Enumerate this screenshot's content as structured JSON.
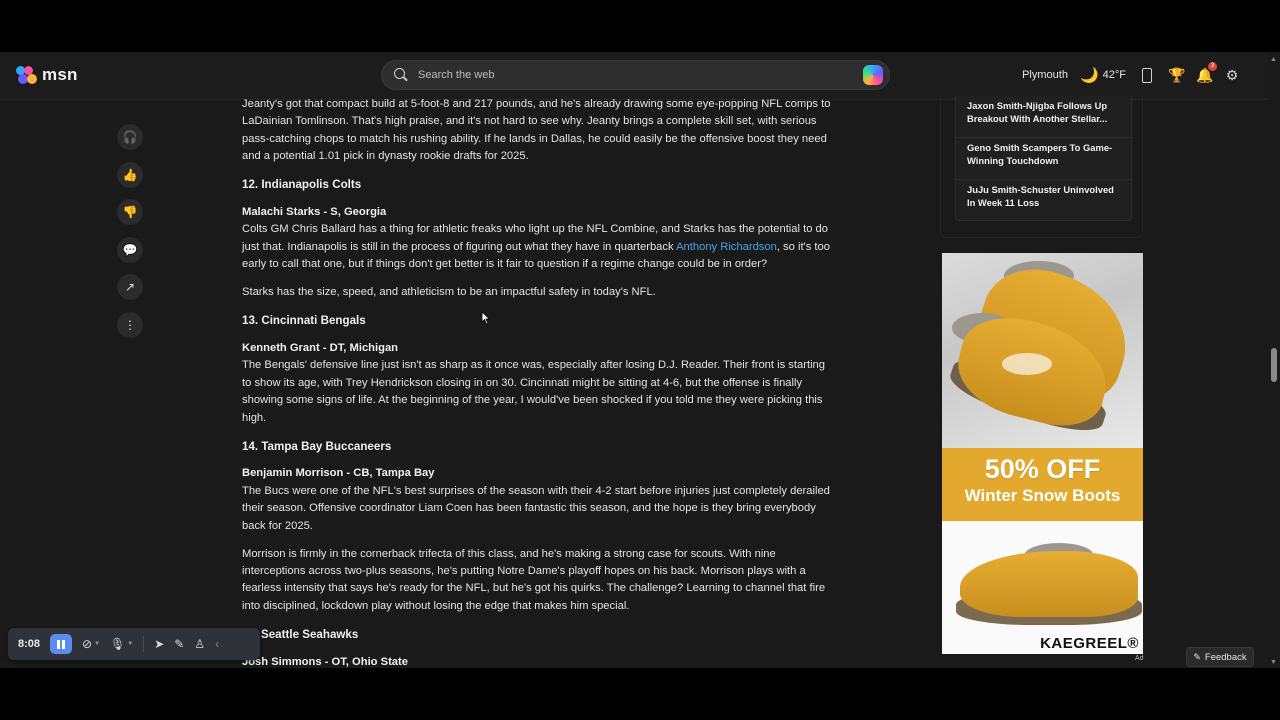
{
  "header": {
    "logo_text": "msn",
    "search_placeholder": "Search the web",
    "location": "Plymouth",
    "temperature": "42°F",
    "notification_count": "3"
  },
  "rail": [
    "headphones-icon",
    "thumbs-up-icon",
    "thumbs-down-icon",
    "comment-icon",
    "share-icon",
    "more-icon"
  ],
  "article": {
    "intro": "Jeanty's got that compact build at 5-foot-8 and 217 pounds, and he's already drawing some eye-popping NFL comps to LaDainian Tomlinson. That's high praise, and it's not hard to see why. Jeanty brings a complete skill set, with serious pass-catching chops to match his rushing ability. If he lands in Dallas, he could easily be the offensive boost they need and a potential 1.01 pick in dynasty rookie drafts for 2025.",
    "s12_title": "12. Indianapolis Colts",
    "s12_player": "Malachi Starks - S, Georgia",
    "s12_p1_a": "Colts GM Chris Ballard has a thing for athletic freaks who light up the NFL Combine, and Starks has the potential to do just that. Indianapolis is still in the process of figuring out what they have in quarterback ",
    "s12_link": "Anthony Richardson",
    "s12_p1_b": ", so it's too early to call that one, but if things don't get better is it fair to question if a regime change could be in order?",
    "s12_p2": "Starks has the size, speed, and athleticism to be an impactful safety in today's NFL.",
    "s13_title": "13. Cincinnati Bengals",
    "s13_player": "Kenneth Grant - DT, Michigan",
    "s13_p1": "The Bengals' defensive line just isn't as sharp as it once was, especially after losing D.J. Reader. Their front is starting to show its age, with Trey Hendrickson closing in on 30. Cincinnati might be sitting at 4-6, but the offense is finally showing some signs of life. At the beginning of the year, I would've been shocked if you told me they were picking this high.",
    "s14_title": "14. Tampa Bay Buccaneers",
    "s14_player": "Benjamin Morrison - CB, Tampa Bay",
    "s14_p1": "The Bucs were one of the NFL's best surprises of the season with their 4-2 start before injuries just completely derailed their season. Offensive coordinator Liam Coen has been fantastic this season, and the hope is they bring everybody back for 2025.",
    "s14_p2": "Morrison is firmly in the cornerback trifecta of this class, and he's making a strong case for scouts. With nine interceptions across two-plus seasons, he's putting Notre Dame's playoff hopes on his back. Morrison plays with a fearless intensity that says he's ready for the NFL, but he's got his quirks. The challenge? Learning to channel that fire into disciplined, lockdown play without losing the edge that makes him special.",
    "s15_title_partial": "Seattle Seahawks",
    "s15_player": "Josh Simmons - OT, Ohio State"
  },
  "trending": [
    "Jaxon Smith-Njigba Follows Up Breakout With Another Stellar...",
    "Geno Smith Scampers To Game-Winning Touchdown",
    "JuJu Smith-Schuster Uninvolved In Week 11 Loss"
  ],
  "ad": {
    "headline": "50% OFF",
    "subline": "Winter Snow Boots",
    "brand": "KAEGREEL®",
    "label": "Ad"
  },
  "feedback_label": "Feedback",
  "recorder": {
    "time": "8:08"
  },
  "colors": {
    "background": "#1a1a1a",
    "link": "#4aa3e8",
    "ad_band": "#e3a82e",
    "pause_button": "#5b8def"
  }
}
